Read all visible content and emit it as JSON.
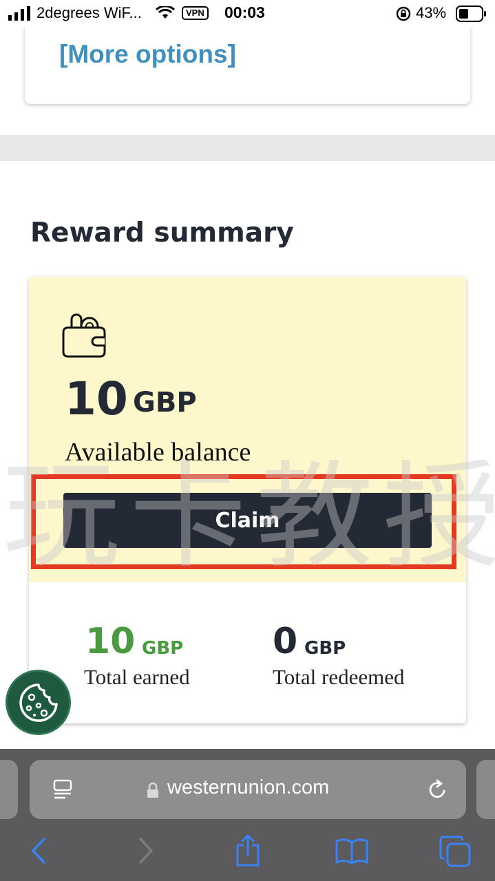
{
  "status_bar": {
    "carrier": "2degrees WiF...",
    "vpn": "VPN",
    "time": "00:03",
    "battery": "43%"
  },
  "top_card": {
    "link": "[More options]"
  },
  "reward_summary": {
    "title": "Reward summary",
    "balance_amount": "10",
    "balance_currency": "GBP",
    "balance_label": "Available balance",
    "claim_label": "Claim",
    "earned": {
      "amount": "10",
      "currency": "GBP",
      "label": "Total earned"
    },
    "redeemed": {
      "amount": "0",
      "currency": "GBP",
      "label": "Total redeemed"
    }
  },
  "watermark": "玩卡教授",
  "browser": {
    "url": "westernunion.com"
  },
  "icons": {
    "wallet": "wallet-icon",
    "cookie": "cookie-icon",
    "reader": "reader-icon",
    "reload": "reload-icon",
    "back": "back-icon",
    "forward": "forward-icon",
    "share": "share-icon",
    "bookmarks": "bookmarks-icon",
    "tabs": "tabs-icon"
  },
  "colors": {
    "primary_dark": "#232a35",
    "balance_bg": "#fef7cb",
    "link": "#3f8fbf",
    "earned_green": "#4a9a3f",
    "cookie_bg": "#1e5b3e",
    "highlight": "#e43a22",
    "ios_blue": "#3a82f7"
  }
}
